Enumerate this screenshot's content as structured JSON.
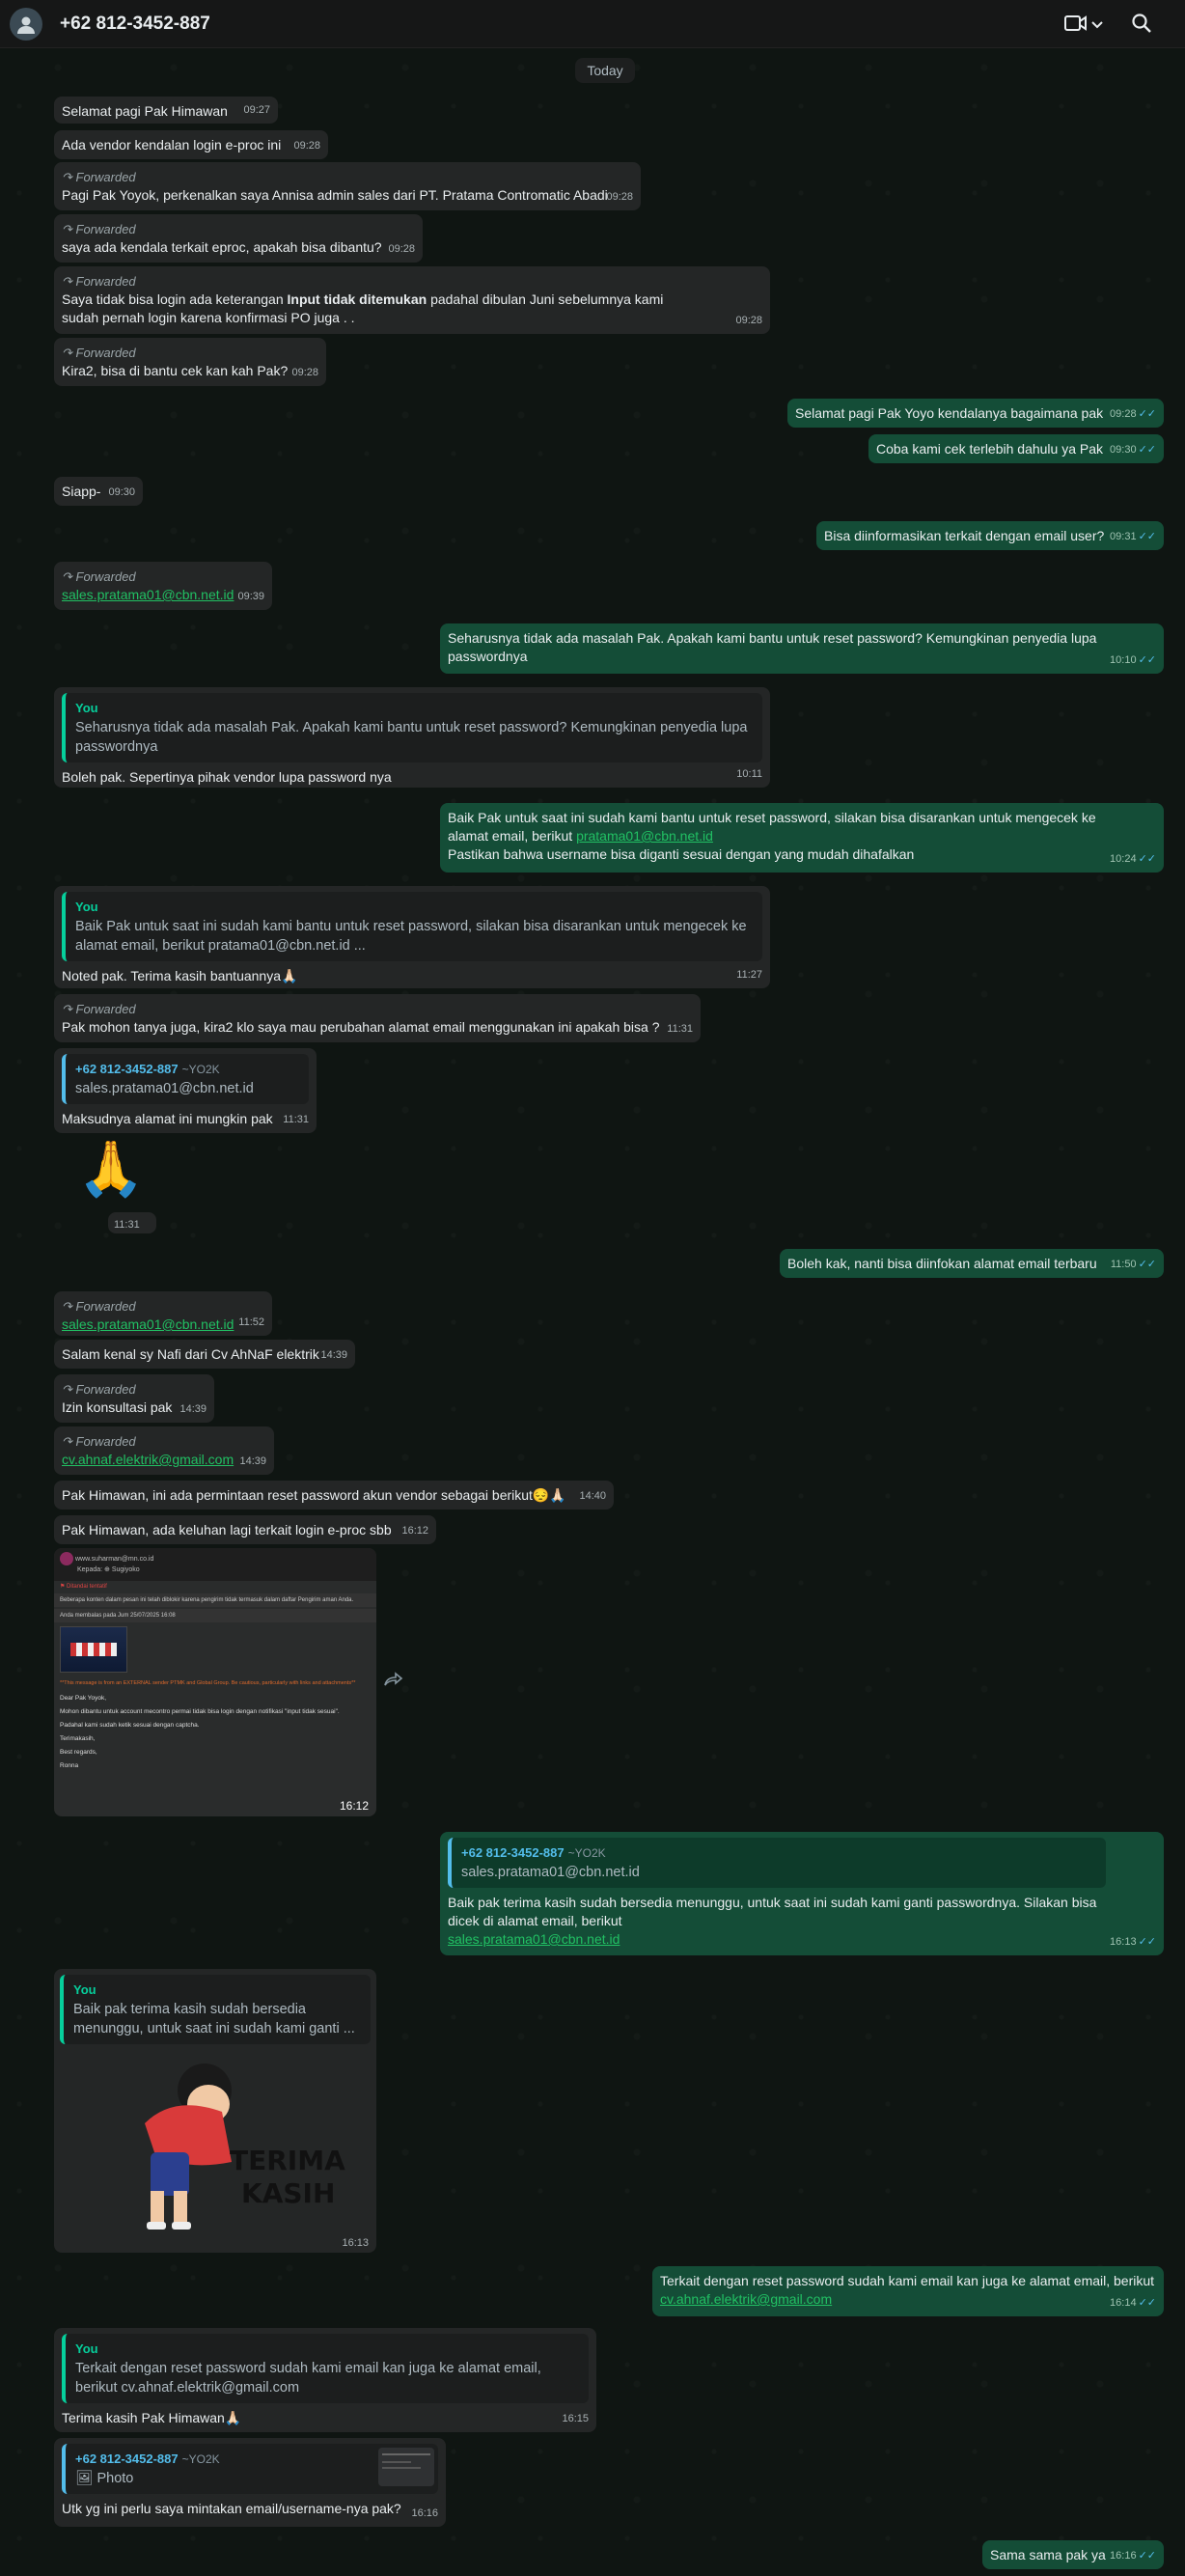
{
  "header": {
    "contact": "+62 812-3452-887",
    "icons": [
      "avatar-icon",
      "video-call-icon",
      "chevron-down-icon",
      "search-icon"
    ]
  },
  "date_chip": "Today",
  "labels": {
    "forwarded": "Forwarded",
    "you": "You",
    "quoted_contact": "+62 812-3452-887",
    "quoted_alias": "~YO2K",
    "photo": "Photo"
  },
  "messages": {
    "m1": {
      "text": "Selamat pagi Pak Himawan",
      "time": "09:27"
    },
    "m2": {
      "text": "Ada vendor kendalan login e-proc ini",
      "time": "09:28"
    },
    "m3": {
      "text": "Pagi Pak Yoyok, perkenalkan saya Annisa admin sales dari PT. Pratama Contromatic Abadi",
      "time": "09:28"
    },
    "m4": {
      "text": "saya ada kendala terkait eproc, apakah bisa dibantu?",
      "time": "09:28"
    },
    "m5": {
      "text_a": "Saya tidak bisa login ada keterangan ",
      "text_bold": "Input tidak ditemukan",
      "text_b": " padahal dibulan Juni sebelumnya kami sudah pernah login karena konfirmasi PO juga . .",
      "time": "09:28"
    },
    "m6": {
      "text": "Kira2, bisa di bantu cek kan kah Pak?",
      "time": "09:28"
    },
    "m7": {
      "text": "Selamat pagi Pak Yoyo kendalanya bagaimana pak",
      "time": "09:28"
    },
    "m8": {
      "text": "Coba kami cek terlebih dahulu ya Pak",
      "time": "09:30"
    },
    "m9": {
      "text": "Siapp-",
      "time": "09:30"
    },
    "m10": {
      "text": "Bisa diinformasikan terkait dengan email user?",
      "time": "09:31"
    },
    "m11": {
      "link": "sales.pratama01@cbn.net.id",
      "time": "09:39"
    },
    "m12": {
      "text": "Seharusnya tidak ada masalah Pak. Apakah kami bantu untuk reset password? Kemungkinan penyedia lupa passwordnya",
      "time": "10:10"
    },
    "m13": {
      "quote": "Seharusnya tidak ada masalah Pak. Apakah kami bantu untuk reset password? Kemungkinan penyedia lupa passwordnya",
      "text": "Boleh pak. Sepertinya pihak vendor lupa password nya",
      "time": "10:11"
    },
    "m14": {
      "text_a": "Baik Pak untuk saat ini sudah kami bantu untuk reset password, silakan bisa disarankan untuk mengecek ke alamat email, berikut ",
      "link": "pratama01@cbn.net.id",
      "text_b": "Pastikan bahwa username bisa diganti sesuai dengan yang mudah dihafalkan",
      "time": "10:24"
    },
    "m15": {
      "quote": "Baik Pak untuk saat ini sudah kami bantu untuk reset password, silakan bisa disarankan untuk mengecek ke alamat email, berikut pratama01@cbn.net.id ...",
      "text": "Noted pak. Terima kasih bantuannya🙏🏻",
      "time": "11:27"
    },
    "m16": {
      "text": "Pak mohon tanya juga, kira2 klo saya mau perubahan alamat email menggunakan ini apakah bisa ?",
      "time": "11:31"
    },
    "m17": {
      "quote": "sales.pratama01@cbn.net.id",
      "text": "Maksudnya alamat ini mungkin pak",
      "time": "11:31"
    },
    "m18": {
      "emoji": "🙏",
      "time": "11:31"
    },
    "m19": {
      "text": "Boleh kak, nanti bisa diinfokan alamat email terbaru",
      "time": "11:50"
    },
    "m20": {
      "link": "sales.pratama01@cbn.net.id",
      "time": "11:52"
    },
    "m21": {
      "text": "Salam kenal sy Nafi dari Cv AhNaF elektrik",
      "time": "14:39"
    },
    "m22": {
      "text": "Izin konsultasi pak",
      "time": "14:39"
    },
    "m23": {
      "link": "cv.ahnaf.elektrik@gmail.com",
      "time": "14:39"
    },
    "m24": {
      "text": "Pak Himawan, ini ada permintaan reset password akun vendor sebagai berikut😔🙏🏻",
      "time": "14:40"
    },
    "m25": {
      "text": "Pak Himawan, ada keluhan lagi terkait login e-proc sbb",
      "time": "16:12"
    },
    "m26": {
      "time": "16:12",
      "email_from": "www.suharman@mn.co.id",
      "email_to": "Kepada: ⊕ Sugiyoko",
      "email_flag": "⚑ Ditandai tentatif",
      "notice1": "Beberapa konten dalam pesan ini telah diblokir karena pengirim tidak termasuk dalam daftar Pengirim aman Anda.",
      "notice2": "Anda membalas pada Jum 25/07/2025 16:08",
      "warning": "**This message is from an EXTERNAL sender PTMK and Global Group. Be cautious, particularly with links and attachments**",
      "body": [
        "Dear Pak Yoyok,",
        "Mohon dibantu untuk account mecontro permai tidak bisa login dengan notifikasi \"input tidak sesuai\".",
        "Padahal kami sudah ketik sesuai dengan captcha.",
        "Terimakasih,",
        "Best regards,",
        "Ronna"
      ]
    },
    "m27": {
      "quote": "sales.pratama01@cbn.net.id",
      "text": "Baik pak terima kasih sudah bersedia menunggu, untuk saat ini sudah kami ganti passwordnya. Silakan bisa dicek di alamat email, berikut",
      "link": "sales.pratama01@cbn.net.id",
      "time": "16:13"
    },
    "m28": {
      "quote": "Baik pak terima kasih sudah bersedia menunggu, untuk saat ini sudah kami ganti ...",
      "sticker_text_1": "TERIMA",
      "sticker_text_2": "KASIH",
      "time": "16:13"
    },
    "m29": {
      "text": "Terkait dengan reset password sudah kami email kan juga ke alamat email, berikut",
      "link": "cv.ahnaf.elektrik@gmail.com",
      "time": "16:14"
    },
    "m30": {
      "quote": "Terkait dengan reset password sudah kami email kan juga ke alamat email, berikut cv.ahnaf.elektrik@gmail.com",
      "text": "Terima kasih Pak Himawan🙏🏻",
      "time": "16:15"
    },
    "m31": {
      "text": "Utk yg ini perlu saya mintakan email/username-nya pak?",
      "time": "16:16"
    },
    "m32": {
      "text": "Sama sama pak ya",
      "time": "16:16"
    }
  },
  "colors": {
    "incoming_bubble": "#242626",
    "outgoing_bubble": "#144d37",
    "accent_green": "#06cf9c",
    "read_ticks": "#53bdeb"
  }
}
